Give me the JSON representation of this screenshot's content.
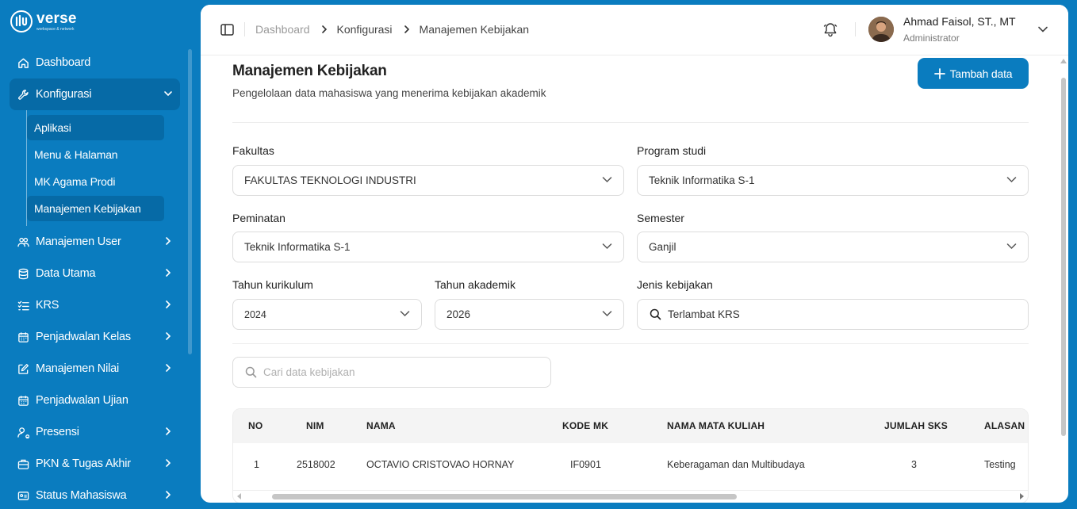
{
  "brand": {
    "name": "verse",
    "tagline": "workspace & network"
  },
  "sidebar": {
    "items": [
      {
        "label": "Dashboard"
      },
      {
        "label": "Konfigurasi"
      },
      {
        "label": "Manajemen User"
      },
      {
        "label": "Data Utama"
      },
      {
        "label": "KRS"
      },
      {
        "label": "Penjadwalan Kelas"
      },
      {
        "label": "Manajemen Nilai"
      },
      {
        "label": "Penjadwalan Ujian"
      },
      {
        "label": "Presensi"
      },
      {
        "label": "PKN & Tugas Akhir"
      },
      {
        "label": "Status Mahasiswa"
      }
    ],
    "konfigurasi_sub": [
      {
        "label": "Aplikasi"
      },
      {
        "label": "Menu & Halaman"
      },
      {
        "label": "MK Agama Prodi"
      },
      {
        "label": "Manajemen Kebijakan"
      }
    ]
  },
  "breadcrumb": [
    "Dashboard",
    "Konfigurasi",
    "Manajemen Kebijakan"
  ],
  "user": {
    "name": "Ahmad Faisol, ST., MT",
    "role": "Administrator"
  },
  "page": {
    "title": "Manajemen Kebijakan",
    "subtitle": "Pengelolaan data mahasiswa yang menerima kebijakan akademik",
    "add_button": "Tambah data"
  },
  "filters": {
    "fakultas": {
      "label": "Fakultas",
      "value": "FAKULTAS TEKNOLOGI INDUSTRI"
    },
    "prodi": {
      "label": "Program studi",
      "value": "Teknik Informatika S-1"
    },
    "peminatan": {
      "label": "Peminatan",
      "value": "Teknik Informatika S-1"
    },
    "semester": {
      "label": "Semester",
      "value": "Ganjil"
    },
    "kurikulum": {
      "label": "Tahun kurikulum",
      "value": "2024"
    },
    "akademik": {
      "label": "Tahun akademik",
      "value": "2026"
    },
    "jenis": {
      "label": "Jenis kebijakan",
      "value": "Terlambat KRS"
    }
  },
  "search": {
    "placeholder": "Cari data kebijakan"
  },
  "table": {
    "headers": {
      "no": "NO",
      "nim": "NIM",
      "nama": "NAMA",
      "kode": "KODE MK",
      "matkul": "NAMA MATA KULIAH",
      "sks": "JUMLAH SKS",
      "alasan": "ALASAN"
    },
    "rows": [
      {
        "no": "1",
        "nim": "2518002",
        "nama": "OCTAVIO CRISTOVAO HORNAY",
        "kode": "IF0901",
        "matkul": "Keberagaman dan Multibudaya",
        "sks": "3",
        "alasan": "Testing"
      }
    ]
  },
  "colors": {
    "primary": "#0a7cbf",
    "sidebar_active": "#066aa6"
  }
}
